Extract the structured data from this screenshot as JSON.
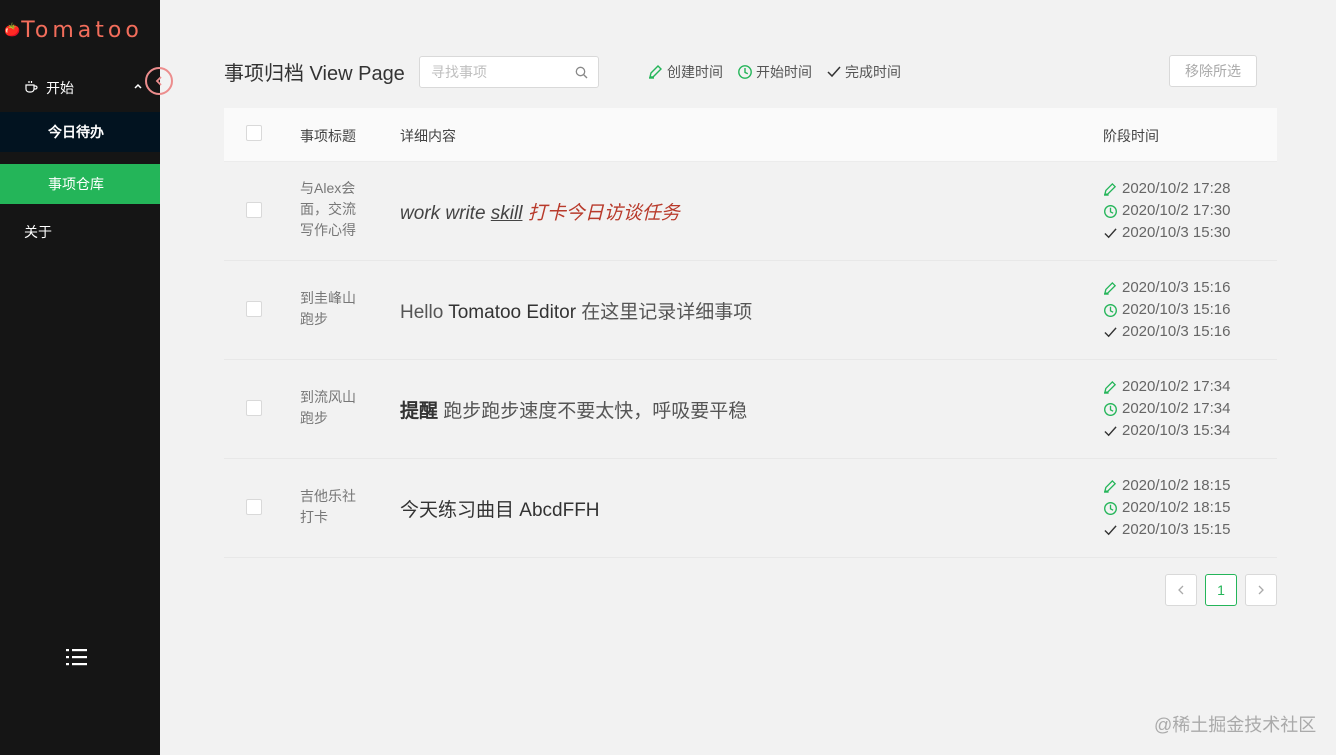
{
  "app": {
    "brand": "Tomatoo",
    "brand_glyph": "🍅"
  },
  "sidebar": {
    "group_label": "开始",
    "submenu": [
      {
        "label": "今日待办"
      },
      {
        "label": "事项仓库"
      }
    ],
    "about_label": "关于"
  },
  "header": {
    "title": "事项归档 View Page",
    "search_placeholder": "寻找事项",
    "legend": [
      {
        "label": "创建时间",
        "icon": "highlighter-icon"
      },
      {
        "label": "开始时间",
        "icon": "clock-icon"
      },
      {
        "label": "完成时间",
        "icon": "check-icon"
      }
    ],
    "clear_label": "移除所选"
  },
  "table": {
    "columns": {
      "title": "事项标题",
      "detail": "详细内容",
      "time": "阶段时间"
    },
    "rows": [
      {
        "title": "与Alex会面，交流写作心得",
        "content": {
          "a": "work write ",
          "b": "skill",
          "c": " 打卡今日访谈任务"
        },
        "created": "2020/10/2 17:28",
        "started": "2020/10/2 17:30",
        "done": "2020/10/3 15:30"
      },
      {
        "title": "到圭峰山跑步",
        "content": {
          "a": "Hello ",
          "b": "Tomatoo Editor",
          "c": " 在这里记录详细事项"
        },
        "created": "2020/10/3 15:16",
        "started": "2020/10/3 15:16",
        "done": "2020/10/3 15:16"
      },
      {
        "title": "到流风山跑步",
        "content": {
          "a": "提醒",
          "b": " 跑步跑步速度不要太快，呼吸要平稳"
        },
        "created": "2020/10/2 17:34",
        "started": "2020/10/2 17:34",
        "done": "2020/10/3 15:34"
      },
      {
        "title": "吉他乐社打卡",
        "content": {
          "a": "今天练习曲目 AbcdFFH"
        },
        "created": "2020/10/2 18:15",
        "started": "2020/10/2 18:15",
        "done": "2020/10/3 15:15"
      }
    ]
  },
  "pagination": {
    "prev": "<",
    "current": "1",
    "next": ">"
  },
  "watermark": "@稀土掘金技术社区",
  "colors": {
    "accent": "#24b559",
    "brand": "#f26d5b",
    "sidebar": "#151515",
    "red_text": "#b83a2b"
  }
}
